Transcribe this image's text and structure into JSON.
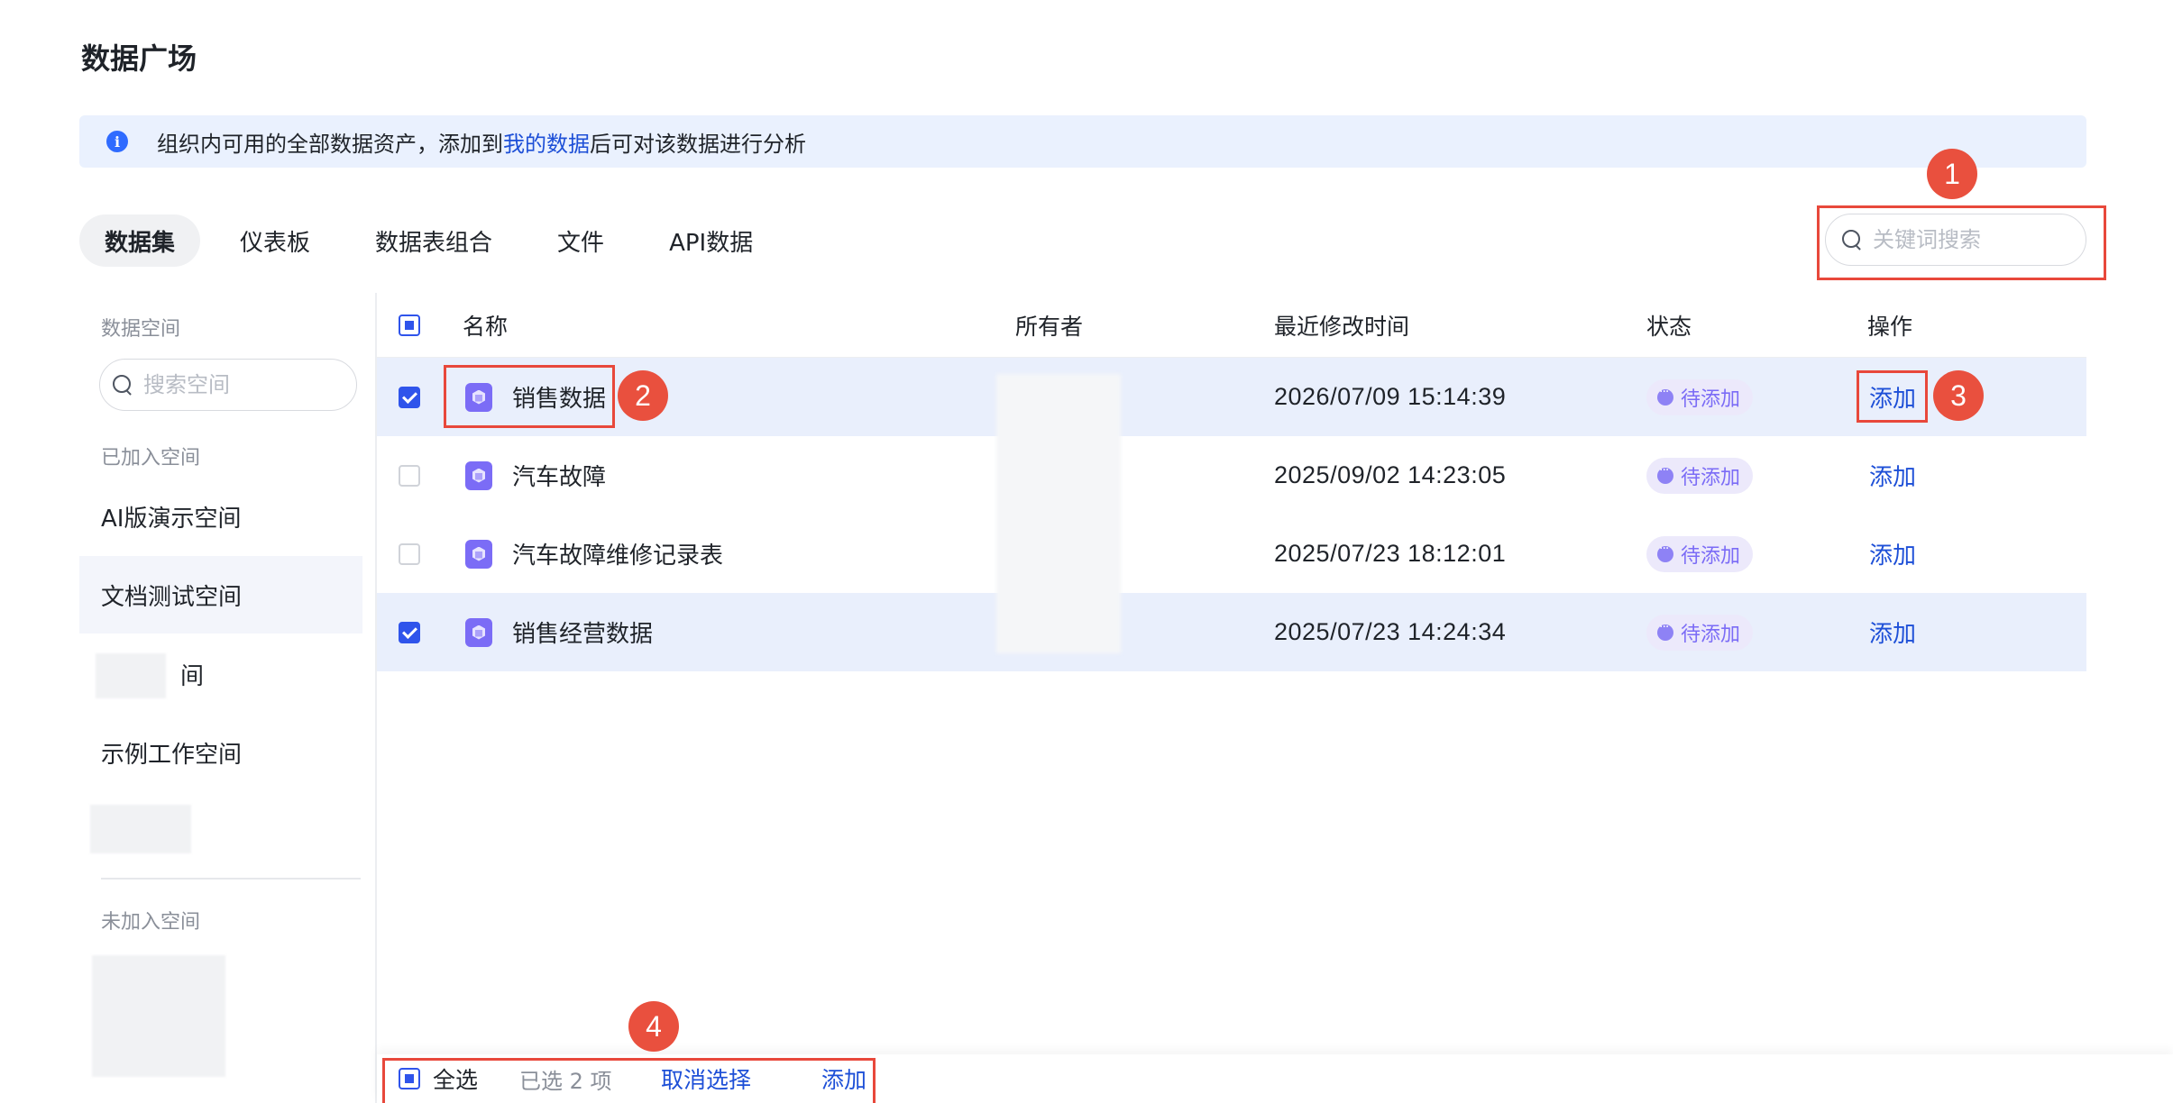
{
  "page": {
    "title": "数据广场"
  },
  "info": {
    "prefix": "组织内可用的全部数据资产，添加到",
    "link": "我的数据",
    "suffix": "后可对该数据进行分析"
  },
  "tabs": [
    {
      "label": "数据集",
      "active": true
    },
    {
      "label": "仪表板",
      "active": false
    },
    {
      "label": "数据表组合",
      "active": false
    },
    {
      "label": "文件",
      "active": false
    },
    {
      "label": "API数据",
      "active": false
    }
  ],
  "search": {
    "placeholder": "关键词搜索"
  },
  "sidebar": {
    "section_title": "数据空间",
    "search_placeholder": "搜索空间",
    "joined_title": "已加入空间",
    "joined": [
      {
        "label": "AI版演示空间"
      },
      {
        "label": "文档测试空间"
      },
      {
        "label": "间"
      },
      {
        "label": "示例工作空间"
      }
    ],
    "not_joined_title": "未加入空间"
  },
  "table": {
    "headers": {
      "name": "名称",
      "owner": "所有者",
      "modified": "最近修改时间",
      "status": "状态",
      "action": "操作"
    },
    "rows": [
      {
        "name": "销售数据",
        "modified": "2026/07/09 15:14:39",
        "status": "待添加",
        "action": "添加",
        "checked": true
      },
      {
        "name": "汽车故障",
        "modified": "2025/09/02 14:23:05",
        "status": "待添加",
        "action": "添加",
        "checked": false
      },
      {
        "name": "汽车故障维修记录表",
        "modified": "2025/07/23 18:12:01",
        "status": "待添加",
        "action": "添加",
        "checked": false
      },
      {
        "name": "销售经营数据",
        "modified": "2025/07/23 14:24:34",
        "status": "待添加",
        "action": "添加",
        "checked": true
      }
    ]
  },
  "footer": {
    "select_all": "全选",
    "selected_count": "已选 2 项",
    "cancel": "取消选择",
    "add": "添加"
  },
  "annotations": [
    "1",
    "2",
    "3",
    "4"
  ],
  "colors": {
    "accent": "#2f54eb",
    "link": "#1d4fd7",
    "highlight": "#e8483b",
    "badge": "#e9503e",
    "status": "#7b6cf6",
    "selected_row": "#e9effc",
    "info_bg": "#eaf1fe"
  }
}
